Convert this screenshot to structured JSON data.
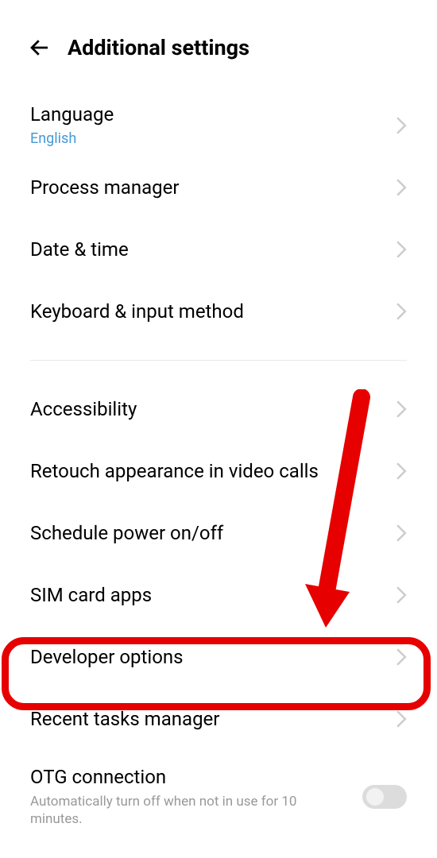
{
  "header": {
    "title": "Additional settings"
  },
  "group1": {
    "language": {
      "label": "Language",
      "value": "English"
    },
    "process_manager": {
      "label": "Process manager"
    },
    "date_time": {
      "label": "Date & time"
    },
    "keyboard": {
      "label": "Keyboard & input method"
    }
  },
  "group2": {
    "accessibility": {
      "label": "Accessibility"
    },
    "retouch": {
      "label": "Retouch appearance in video calls"
    },
    "schedule_power": {
      "label": "Schedule power on/off"
    },
    "sim_apps": {
      "label": "SIM card apps"
    },
    "developer_options": {
      "label": "Developer options"
    },
    "recent_tasks": {
      "label": "Recent tasks manager"
    },
    "otg": {
      "label": "OTG connection",
      "description": "Automatically turn off when not in use for 10 minutes.",
      "toggle": false
    }
  },
  "annotation": {
    "highlight_target": "developer_options",
    "arrow_color": "#e60000"
  }
}
